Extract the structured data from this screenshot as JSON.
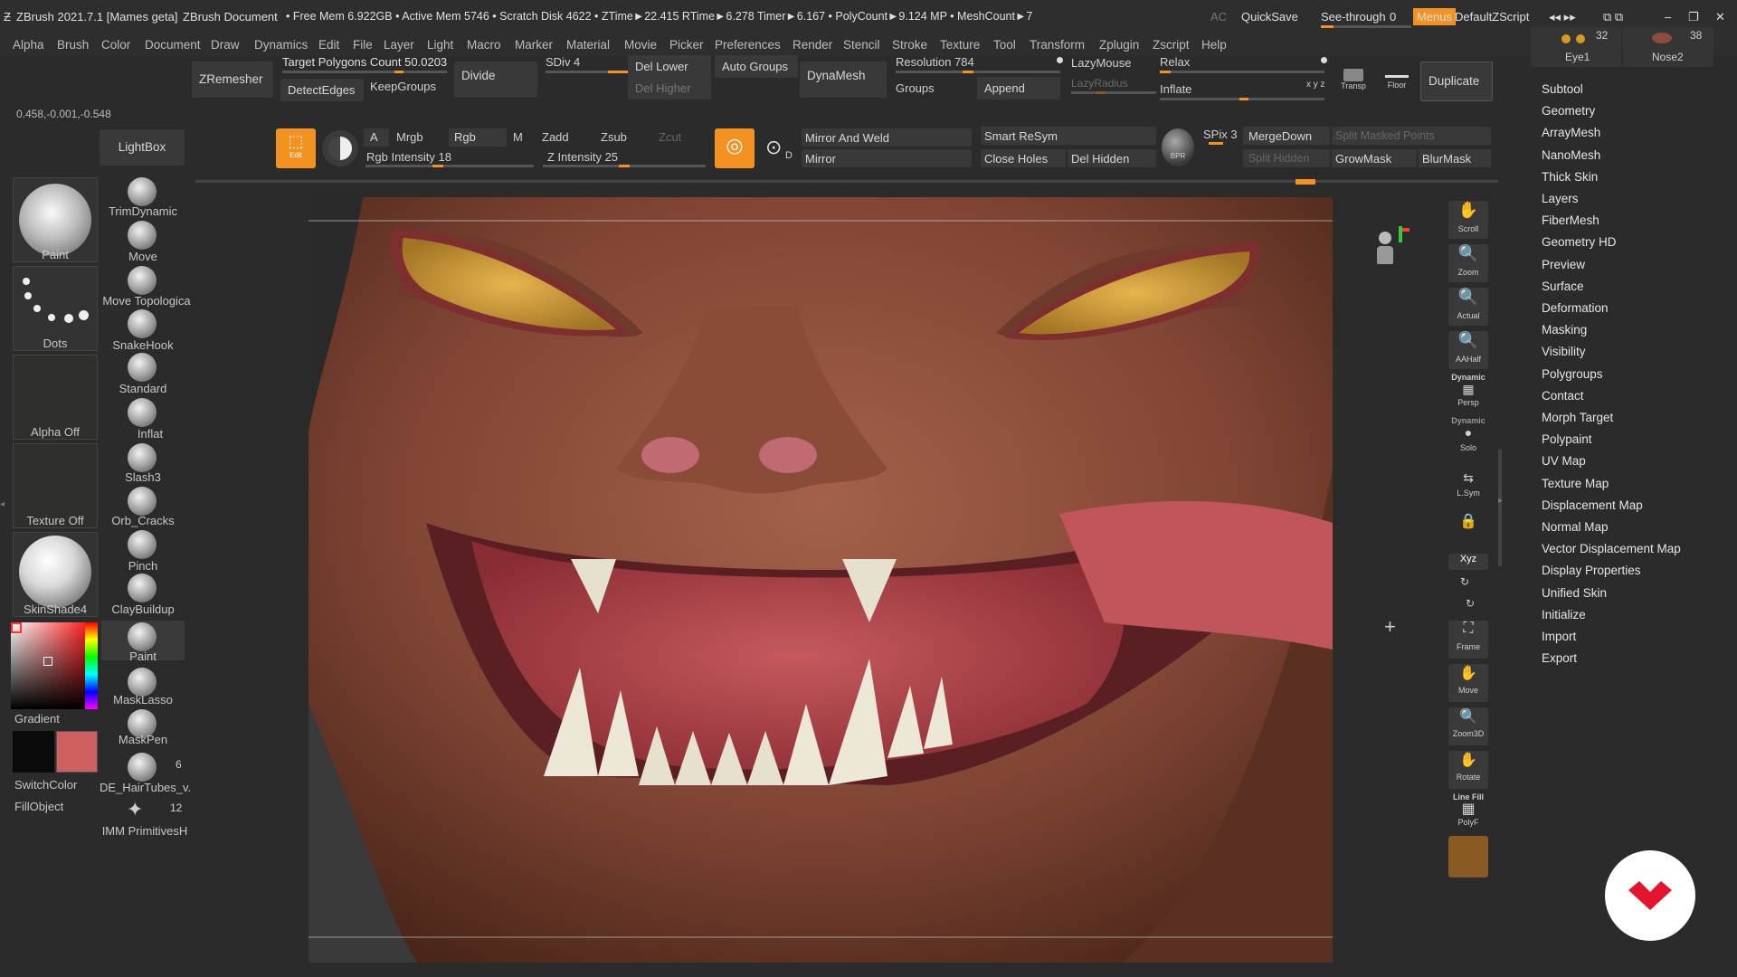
{
  "titlebar": {
    "app": "ZBrush 2021.7.1 [Mames geta]",
    "doc": "ZBrush Document",
    "stats": "• Free Mem 6.922GB • Active Mem 5746 • Scratch Disk 4622 • ZTime►22.415 RTime►6.278 Timer►6.167 • PolyCount►9.124 MP • MeshCount►7",
    "ac": "AC",
    "quicksave": "QuickSave",
    "see_through": "See-through",
    "see_through_value": "0",
    "menus": "Menus",
    "zscript": "DefaultZScript"
  },
  "menu": [
    "Alpha",
    "Brush",
    "Color",
    "Document",
    "Draw",
    "Dynamics",
    "Edit",
    "File",
    "Layer",
    "Light",
    "Macro",
    "Marker",
    "Material",
    "Movie",
    "Picker",
    "Preferences",
    "Render",
    "Stencil",
    "Stroke",
    "Texture",
    "Tool",
    "Transform",
    "Zplugin",
    "Zscript",
    "Help"
  ],
  "shelf": {
    "zremesher": "ZRemesher",
    "target_polys": "Target Polygons Count",
    "target_polys_value": "50.0203",
    "detect_edges": "DetectEdges",
    "keep_groups": "KeepGroups",
    "divide": "Divide",
    "sdiv": "SDiv 4",
    "del_lower": "Del Lower",
    "del_higher": "Del Higher",
    "auto_groups": "Auto Groups",
    "dynamesh": "DynaMesh",
    "resolution": "Resolution 784",
    "groups": "Groups",
    "append": "Append",
    "lazymouse": "LazyMouse",
    "lazyradius": "LazyRadius",
    "relax": "Relax",
    "inflate": "Inflate",
    "transp": "Transp",
    "floor": "Floor",
    "duplicate": "Duplicate",
    "eye1": "Eye1",
    "nose2": "Nose2",
    "eye_count": "32",
    "nose_count": "38"
  },
  "coords": "0.458,-0.001,-0.548",
  "lightbox": "LightBox",
  "draw_shelf": {
    "edit": "Edit",
    "a": "A",
    "mrgb": "Mrgb",
    "rgb": "Rgb",
    "m": "M",
    "zadd": "Zadd",
    "zsub": "Zsub",
    "zcut": "Zcut",
    "rgb_intensity": "Rgb Intensity 18",
    "z_intensity": "Z Intensity 25",
    "mirror_weld": "Mirror And Weld",
    "mirror": "Mirror",
    "smart_resym": "Smart ReSym",
    "close_holes": "Close Holes",
    "del_hidden": "Del Hidden",
    "bpr": "BPR",
    "spix": "SPix 3",
    "merge_down": "MergeDown",
    "split_masked": "Split Masked Points",
    "split_hidden": "Split Hidden",
    "grow_mask": "GrowMask",
    "blur_mask": "BlurMask",
    "d": "D"
  },
  "left_panel": {
    "paint": "Paint",
    "dots": "Dots",
    "alpha_off": "Alpha Off",
    "texture_off": "Texture Off",
    "material": "SkinShade4",
    "gradient": "Gradient",
    "switch_color": "SwitchColor",
    "fill_object": "FillObject",
    "secondary_color": "#d06060",
    "main_color": "#0a0a0a"
  },
  "brushes": [
    "TrimDynamic",
    "Move",
    "Move Topologica",
    "SnakeHook",
    "Standard",
    "Inflat",
    "Slash3",
    "Orb_Cracks",
    "Pinch",
    "ClayBuildup",
    "Paint",
    "MaskLasso",
    "MaskPen",
    "DE_HairTubes_v.",
    "IMM PrimitivesH"
  ],
  "brush_counts": {
    "hair": "6",
    "imm": "12"
  },
  "right_toolbar": [
    "Scroll",
    "Zoom",
    "Actual",
    "AAHalf",
    "Persp",
    "Solo",
    "L.Sym",
    "",
    "Xyz",
    "",
    "",
    "Frame",
    "Move",
    "Zoom3D",
    "Rotate",
    "PolyF",
    ""
  ],
  "right_toolbar_extra": {
    "dynamic": "Dynamic",
    "dynamic2": "Dynamic",
    "linefill": "Line Fill"
  },
  "tool_menu": [
    "Subtool",
    "Geometry",
    "ArrayMesh",
    "NanoMesh",
    "Thick Skin",
    "Layers",
    "FiberMesh",
    "Geometry HD",
    "Preview",
    "Surface",
    "Deformation",
    "Masking",
    "Visibility",
    "Polygroups",
    "Contact",
    "Morph Target",
    "Polypaint",
    "UV Map",
    "Texture Map",
    "Displacement Map",
    "Normal Map",
    "Vector Displacement Map",
    "Display Properties",
    "Unified Skin",
    "Initialize",
    "Import",
    "Export"
  ]
}
